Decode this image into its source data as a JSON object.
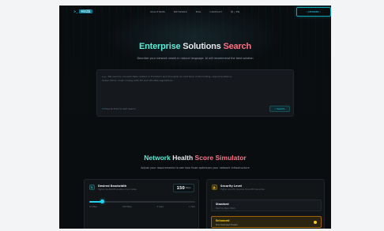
{
  "nav": {
    "logo_mark": ">_",
    "logo_text": "HUZE",
    "links": [
      "SOLUTIONS",
      "NETWORK",
      "ESG",
      "CONTACT",
      "中 | EN"
    ],
    "cta": "⟨ MEMBER ⟩"
  },
  "hero": {
    "title_part1": "Enterprise",
    "title_part2": " Solutions ",
    "title_part3": "Search",
    "subtitle": "Describe your network needs in natural language. AI will recommend the best solution"
  },
  "search": {
    "placeholder": "e.g., We need to connect data centers in Frankfurt and Shanghai for real-time multi-trading, requiring latency below 50ms, must comply with EU and CN data regulations...",
    "tip_arrow": "⏎",
    "tip": "Press ⌘ Enter to start Search",
    "button": "⌕ Search"
  },
  "simulator": {
    "title_part1": "Network",
    "title_part2": " Health ",
    "title_part3": "Score Simulator",
    "subtitle": "Adjust your requirements to see how Huze optimizes your network infrastructure"
  },
  "bandwidth": {
    "icon": "⇅",
    "title": "Desired Bandwidth",
    "desc": "Higher bandwidth enables more routes",
    "value": "150",
    "unit": "Mbps",
    "level": 0.12,
    "ticks": [
      "10 Mbps",
      "500 Mbps",
      "5 Gbps",
      "1 Tbps"
    ]
  },
  "security": {
    "icon": "🔒",
    "title": "Security Level",
    "desc": "Higher security requires more DDI resources",
    "options": [
      {
        "name": "Standard",
        "desc": "SSL/TLS, Basic DDoS"
      },
      {
        "name": "Enhanced",
        "desc": "Plus Dedicated Firewall"
      }
    ]
  },
  "colors": {
    "accent": "#22d3ee",
    "highlight": "#fb7185",
    "warning": "#facc15",
    "background": "#0a0d10"
  }
}
